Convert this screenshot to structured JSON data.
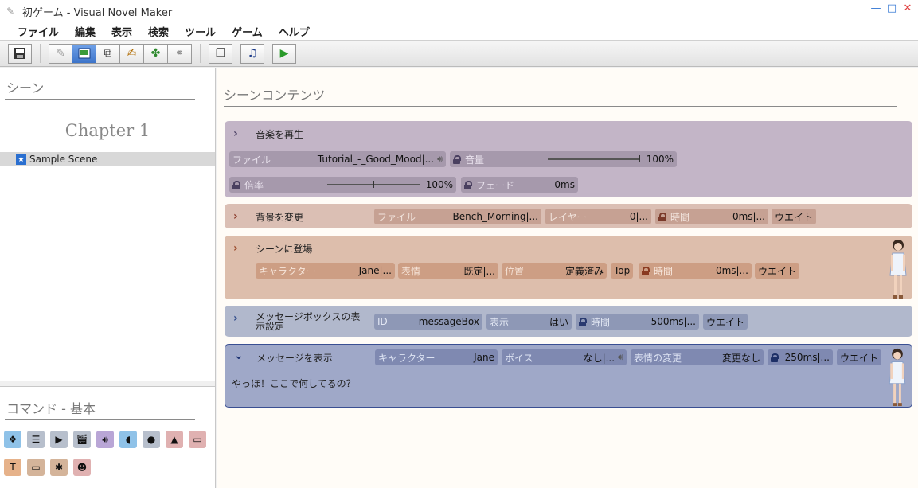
{
  "window": {
    "title": "初ゲーム - Visual Novel Maker",
    "controls": {
      "minimize": "—",
      "maximize": "□",
      "close": "✕"
    }
  },
  "menu": [
    "ファイル",
    "編集",
    "表示",
    "検索",
    "ツール",
    "ゲーム",
    "ヘルプ"
  ],
  "toolbar": {
    "buttons": [
      "save-icon",
      "pen-icon",
      "scene-icon",
      "copy-icon",
      "edit-icon",
      "puzzle-icon",
      "link-icon",
      "stack-icon",
      "music-note-icon",
      "play-icon"
    ],
    "active": "scene-icon",
    "colors": {
      "active": "#3d74c9",
      "play": "#2a9a2a"
    }
  },
  "scene_pane": {
    "title": "シーン",
    "chapter": "Chapter 1",
    "scenes": [
      {
        "label": "Sample Scene",
        "selected": true
      }
    ]
  },
  "command_pane": {
    "title": "コマンド - 基本",
    "icons": [
      "diamond-icon",
      "list-icon",
      "video-icon",
      "clapper-icon",
      "volume-icon",
      "voice-icon",
      "speech-bubble-icon",
      "landscape-icon",
      "folder-icon",
      "text-icon",
      "screen-icon",
      "gear-icon",
      "face-icon"
    ]
  },
  "content": {
    "title": "シーンコンテンツ",
    "commands": [
      {
        "name": "音楽を再生",
        "fields": {
          "file_label": "ファイル",
          "file_value": "Tutorial_-_Good_Mood|...",
          "volume_label": "音量",
          "volume_value": "100%",
          "volume_level": 1.0,
          "rate_label": "倍率",
          "rate_value": "100%",
          "rate_level": 0.5,
          "fade_label": "フェード",
          "fade_value": "0ms"
        }
      },
      {
        "name": "背景を変更",
        "fields": {
          "file_label": "ファイル",
          "file_value": "Bench_Morning|...",
          "layer_label": "レイヤー",
          "layer_value": "0|...",
          "time_label": "時間",
          "time_value": "0ms|...",
          "wait": "ウエイト"
        }
      },
      {
        "name": "シーンに登場",
        "fields": {
          "char_label": "キャラクター",
          "char_value": "Jane|...",
          "expr_label": "表情",
          "expr_value": "既定|...",
          "pos_label": "位置",
          "pos_value": "定義済み",
          "top": "Top",
          "time_label": "時間",
          "time_value": "0ms|...",
          "wait": "ウエイト"
        }
      },
      {
        "name": "メッセージボックスの表示設定",
        "fields": {
          "id_label": "ID",
          "id_value": "messageBox",
          "visible_label": "表示",
          "visible_value": "はい",
          "time_label": "時間",
          "time_value": "500ms|...",
          "wait": "ウエイト"
        }
      },
      {
        "name": "メッセージを表示",
        "fields": {
          "char_label": "キャラクター",
          "char_value": "Jane",
          "voice_label": "ボイス",
          "voice_value": "なし|...",
          "exprchange_label": "表情の変更",
          "exprchange_value": "変更なし",
          "time_value": "250ms|...",
          "wait": "ウエイト"
        },
        "text": "やっほ！ここで何してるの？"
      }
    ]
  }
}
